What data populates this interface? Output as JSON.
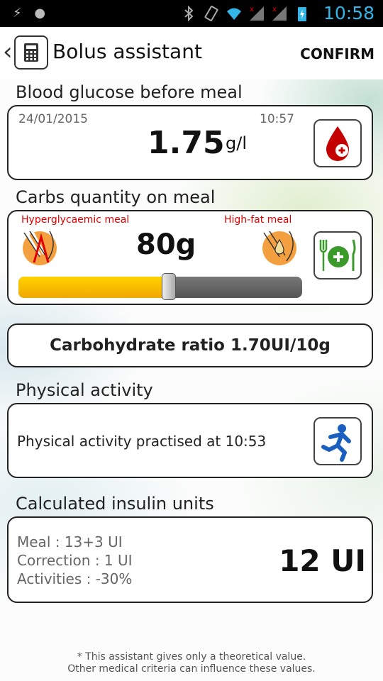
{
  "status_bar": {
    "time": "10:58"
  },
  "action_bar": {
    "title": "Bolus assistant",
    "confirm_label": "CONFIRM"
  },
  "glucose": {
    "section_title": "Blood glucose before meal",
    "date": "24/01/2015",
    "time": "10:57",
    "value": "1.75",
    "unit": "g/l"
  },
  "carbs": {
    "section_title": "Carbs quantity on meal",
    "left_label": "Hyperglycaemic meal",
    "right_label": "High-fat meal",
    "value": "80g",
    "slider_fraction": 0.53
  },
  "ratio": {
    "label": "Carbohydrate ratio 1.70UI/10g"
  },
  "activity": {
    "section_title": "Physical activity",
    "text": "Physical activity practised at 10:53"
  },
  "insulin": {
    "section_title": "Calculated insulin units",
    "meal": "Meal : 13+3 UI",
    "correction": "Correction : 1 UI",
    "activities": "Activities : -30%",
    "total": "12 UI"
  },
  "footer": {
    "line1": "* This assistant gives only a theoretical value.",
    "line2": "Other medical criteria can influence these values."
  },
  "colors": {
    "accent": "#33b5e5",
    "slider_fill": "#f5b800",
    "alert_red": "#e00000",
    "green": "#3a9a2a"
  }
}
